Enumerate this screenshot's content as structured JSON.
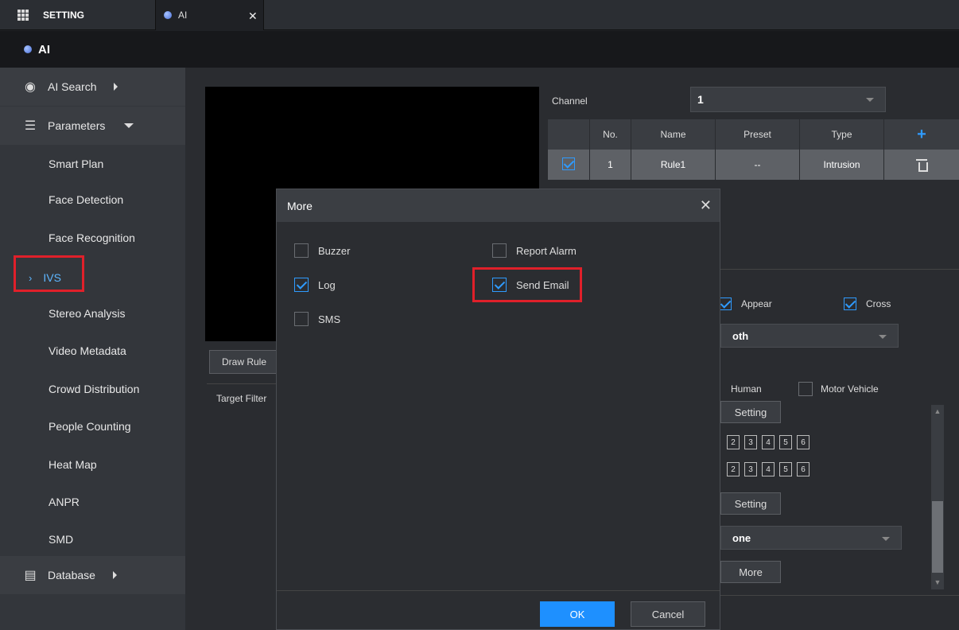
{
  "tabs": {
    "setting_label": "SETTING",
    "ai_label": "AI",
    "close_glyph": "✕"
  },
  "title": "AI",
  "sidebar": {
    "ai_search": "AI Search",
    "parameters": "Parameters",
    "items": [
      {
        "label": "Smart Plan"
      },
      {
        "label": "Face Detection"
      },
      {
        "label": "Face Recognition"
      },
      {
        "label": "IVS",
        "selected": true
      },
      {
        "label": "Stereo Analysis"
      },
      {
        "label": "Video Metadata"
      },
      {
        "label": "Crowd Distribution"
      },
      {
        "label": "People Counting"
      },
      {
        "label": "Heat Map"
      },
      {
        "label": "ANPR"
      },
      {
        "label": "SMD"
      }
    ],
    "database": "Database"
  },
  "main": {
    "draw_rule": "Draw Rule",
    "target_filter": "Target Filter",
    "channel_label": "Channel",
    "channel_value": "1",
    "table": {
      "headers": [
        "No.",
        "Name",
        "Preset",
        "Type"
      ],
      "rows": [
        {
          "no": "1",
          "name": "Rule1",
          "preset": "--",
          "type": "Intrusion"
        }
      ]
    },
    "appear": "Appear",
    "cross": "Cross",
    "direction_value": "oth",
    "human": "Human",
    "motor_vehicle": "Motor Vehicle",
    "setting1": "Setting",
    "setting2": "Setting",
    "numbers": [
      "2",
      "3",
      "4",
      "5",
      "6"
    ],
    "select2_value": "one",
    "more_btn": "More"
  },
  "dialog": {
    "title": "More",
    "options": [
      {
        "label": "Buzzer",
        "checked": false
      },
      {
        "label": "Report Alarm",
        "checked": false
      },
      {
        "label": "Log",
        "checked": true
      },
      {
        "label": "Send Email",
        "checked": true
      },
      {
        "label": "SMS",
        "checked": false
      }
    ],
    "ok": "OK",
    "cancel": "Cancel"
  },
  "colors": {
    "accent": "#1e90ff",
    "highlight_red": "#e0202a"
  }
}
